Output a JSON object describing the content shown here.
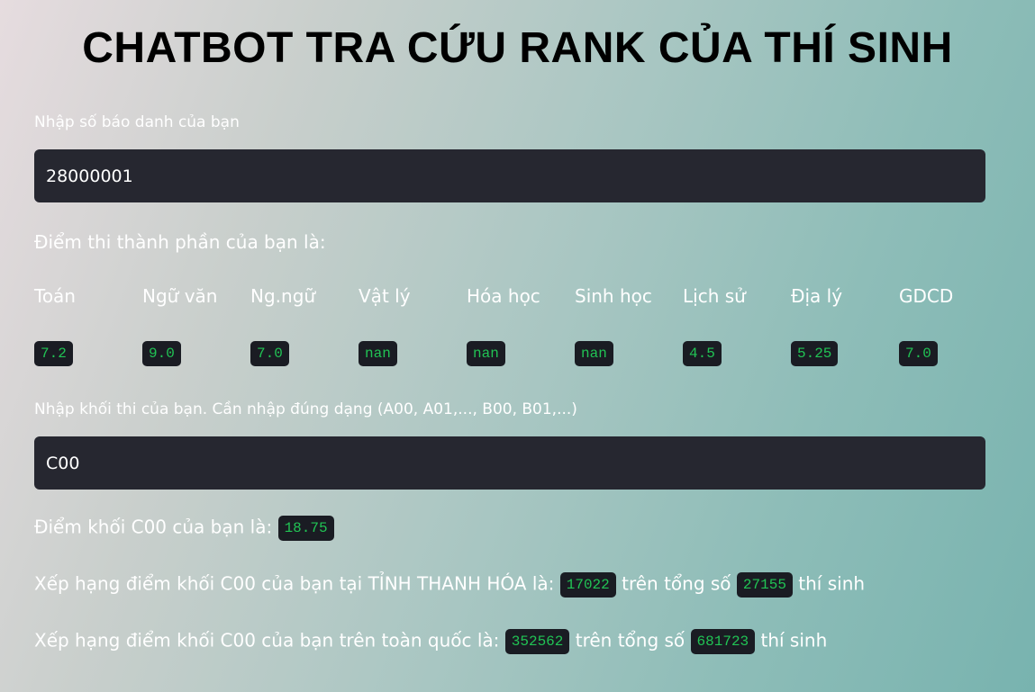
{
  "title": "CHATBOT TRA CỨU RANK CỦA THÍ SINH",
  "sbd": {
    "label": "Nhập số báo danh của bạn",
    "value": "28000001"
  },
  "scores": {
    "heading": "Điểm thi thành phần của bạn là:",
    "subjects": [
      {
        "name": "Toán",
        "score": "7.2"
      },
      {
        "name": "Ngữ văn",
        "score": "9.0"
      },
      {
        "name": "Ng.ngữ",
        "score": "7.0"
      },
      {
        "name": "Vật lý",
        "score": "nan"
      },
      {
        "name": "Hóa học",
        "score": "nan"
      },
      {
        "name": "Sinh học",
        "score": "nan"
      },
      {
        "name": "Lịch sử",
        "score": "4.5"
      },
      {
        "name": "Địa lý",
        "score": "5.25"
      },
      {
        "name": "GDCD",
        "score": "7.0"
      }
    ]
  },
  "khoi": {
    "label": "Nhập khối thi của bạn. Cần nhập đúng dạng (A00, A01,..., B00, B01,...)",
    "value": "C00"
  },
  "result": {
    "block_score_prefix": "Điểm khối C00 của bạn là:",
    "block_score": "18.75",
    "province_prefix": "Xếp hạng điểm khối C00 của bạn tại TỈNH THANH HÓA là:",
    "province_rank": "17022",
    "province_mid": "trên tổng số",
    "province_total": "27155",
    "province_suffix": "thí sinh",
    "national_prefix": "Xếp hạng điểm khối C00 của bạn trên toàn quốc là:",
    "national_rank": "352562",
    "national_mid": "trên tổng số",
    "national_total": "681723",
    "national_suffix": "thí sinh"
  },
  "colors": {
    "input_bg": "#262730",
    "code_bg": "#1a1c23",
    "code_text": "#21c354"
  }
}
